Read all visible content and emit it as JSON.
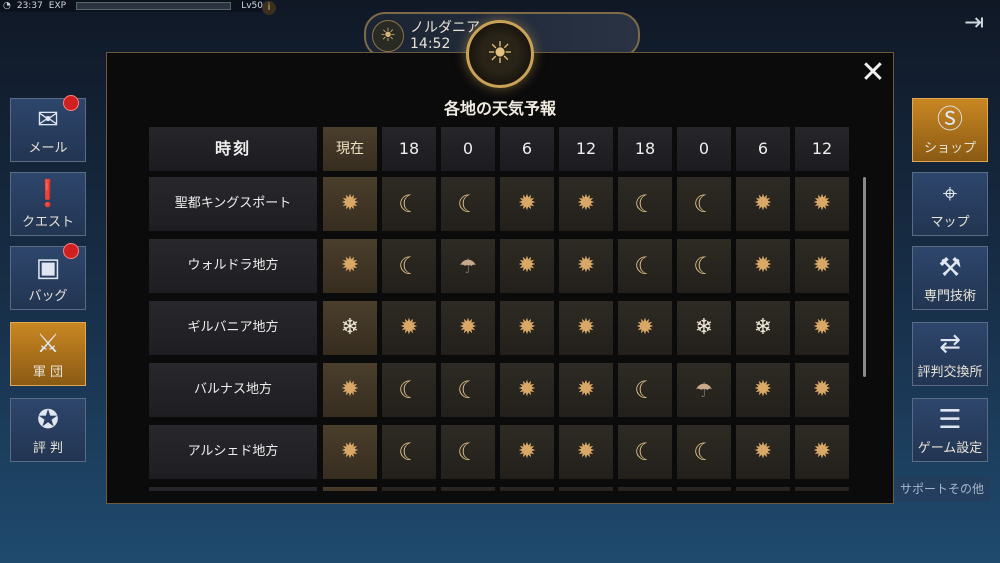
{
  "status": {
    "time": "23:37",
    "exp_label": "EXP",
    "level": "Lv50",
    "info": "i"
  },
  "location": {
    "name": "ノルダニア",
    "time": "14:52"
  },
  "left_menu": {
    "mail": "メール",
    "quest": "クエスト",
    "bag": "バッグ",
    "guild": "軍 団",
    "reputation": "評 判"
  },
  "right_menu": {
    "shop": "ショップ",
    "map": "マップ",
    "skills": "専門技術",
    "exchange_partial": "所",
    "exchange": "評判交換所",
    "settings": "ゲーム設定",
    "support": "サポートその他"
  },
  "forecast": {
    "title": "各地の天気予報",
    "close": "✕",
    "time_header": "時刻",
    "now_header": "現在",
    "times": [
      "18",
      "0",
      "6",
      "12",
      "18",
      "0",
      "6",
      "12"
    ],
    "rows": [
      {
        "region": "聖都キングスポート",
        "now": "sun",
        "slots": [
          "moon",
          "moon",
          "sun",
          "sun",
          "moon",
          "moon",
          "sun",
          "sun"
        ]
      },
      {
        "region": "ウォルドラ地方",
        "now": "sun",
        "slots": [
          "moon",
          "rain",
          "sun",
          "sun",
          "moon",
          "moon",
          "sun",
          "sun"
        ]
      },
      {
        "region": "ギルバニア地方",
        "now": "snow",
        "slots": [
          "sun",
          "sun",
          "sun",
          "sun",
          "sun",
          "snow",
          "snow",
          "sun"
        ]
      },
      {
        "region": "バルナス地方",
        "now": "sun",
        "slots": [
          "moon",
          "moon",
          "sun",
          "sun",
          "moon",
          "rain",
          "sun",
          "sun"
        ]
      },
      {
        "region": "アルシェド地方",
        "now": "sun",
        "slots": [
          "moon",
          "moon",
          "sun",
          "sun",
          "moon",
          "moon",
          "sun",
          "sun"
        ]
      }
    ]
  },
  "icons": {
    "sun": "✹",
    "moon": "☾",
    "snow": "❄",
    "rain": "☂"
  },
  "colors": {
    "accent_gold": "#c9a257",
    "brand_orange": "#c98722"
  }
}
